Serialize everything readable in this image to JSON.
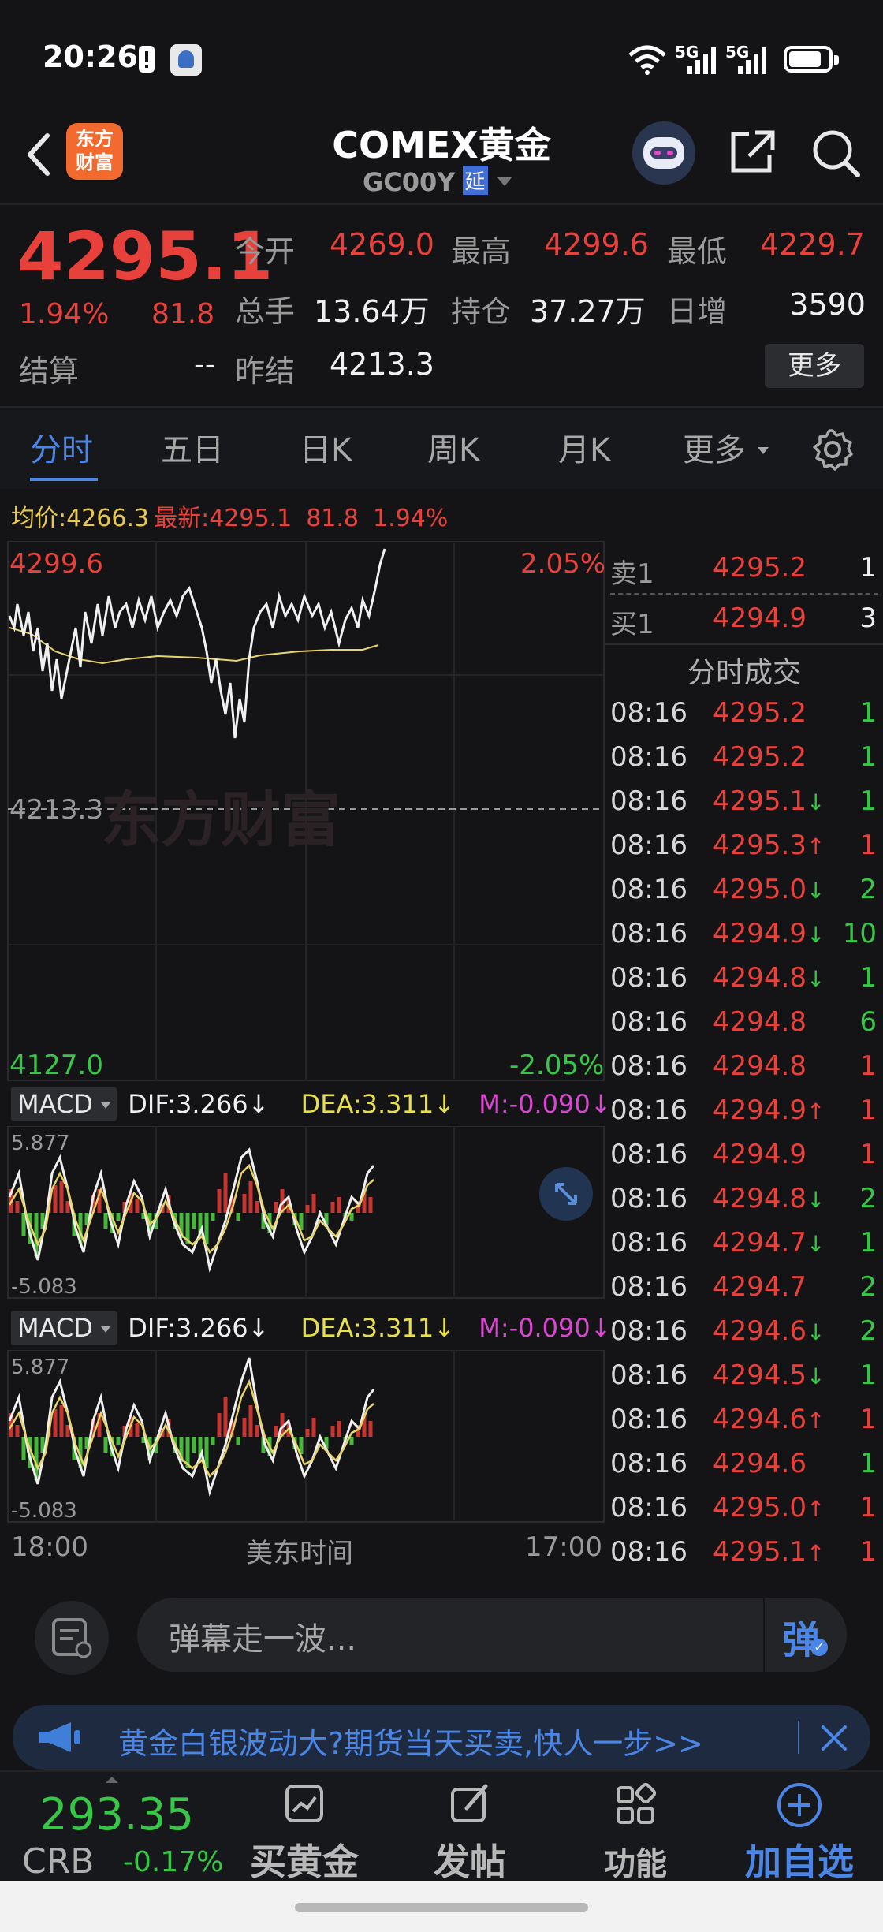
{
  "status_bar": {
    "time": "20:26",
    "signal1": "5G",
    "signal2": "5G"
  },
  "header": {
    "back_label": "<",
    "logo_line1": "东方",
    "logo_line2": "财富",
    "title": "COMEX黄金",
    "code": "GC00Y",
    "delay_badge": "延"
  },
  "quote": {
    "price": "4295.1",
    "change_pct": "1.94%",
    "change_abs": "81.8",
    "open_label": "今开",
    "open": "4269.0",
    "high_label": "最高",
    "high": "4299.6",
    "low_label": "最低",
    "low": "4229.7",
    "volume_label": "总手",
    "volume": "13.64万",
    "oi_label": "持仓",
    "oi": "37.27万",
    "daily_inc_label": "日增",
    "daily_inc": "3590",
    "settle_label": "结算",
    "settle": "--",
    "prev_settle_label": "昨结",
    "prev_settle": "4213.3",
    "more_button": "更多"
  },
  "tabs": {
    "t1": "分时",
    "t2": "五日",
    "t3": "日K",
    "t4": "周K",
    "t5": "月K",
    "t6": "更多"
  },
  "info_line": {
    "avg_label": "均价:",
    "avg": "4266.3",
    "latest_label": "最新:",
    "latest": "4295.1",
    "chg": "81.8",
    "pct": "1.94%"
  },
  "chart": {
    "max_label": "4299.6",
    "max_pct": "2.05%",
    "mid_label": "4213.3",
    "min_label": "4127.0",
    "min_pct": "-2.05%",
    "watermark": "东方财富",
    "time_start": "18:00",
    "time_mid": "美东时间",
    "time_end": "17:00"
  },
  "macd1": {
    "name": "MACD",
    "dif": "DIF:3.266↓",
    "dea": "DEA:3.311↓",
    "m": "M:-0.090↓",
    "top": "5.877",
    "bottom": "-5.083"
  },
  "macd2": {
    "name": "MACD",
    "dif": "DIF:3.266↓",
    "dea": "DEA:3.311↓",
    "m": "M:-0.090↓",
    "top": "5.877",
    "bottom": "-5.083"
  },
  "orderbook": {
    "sell_label": "卖1",
    "sell_price": "4295.2",
    "sell_vol": "1",
    "buy_label": "买1",
    "buy_price": "4294.9",
    "buy_vol": "3",
    "trades_title": "分时成交",
    "trades": [
      {
        "time": "08:16",
        "price": "4295.2",
        "arrow": "",
        "vol": "1",
        "vol_color": "green"
      },
      {
        "time": "08:16",
        "price": "4295.2",
        "arrow": "",
        "vol": "1",
        "vol_color": "green"
      },
      {
        "time": "08:16",
        "price": "4295.1",
        "arrow": "↓",
        "vol": "1",
        "vol_color": "green"
      },
      {
        "time": "08:16",
        "price": "4295.3",
        "arrow": "↑",
        "vol": "1",
        "vol_color": "red"
      },
      {
        "time": "08:16",
        "price": "4295.0",
        "arrow": "↓",
        "vol": "2",
        "vol_color": "green"
      },
      {
        "time": "08:16",
        "price": "4294.9",
        "arrow": "↓",
        "vol": "10",
        "vol_color": "green"
      },
      {
        "time": "08:16",
        "price": "4294.8",
        "arrow": "↓",
        "vol": "1",
        "vol_color": "green"
      },
      {
        "time": "08:16",
        "price": "4294.8",
        "arrow": "",
        "vol": "6",
        "vol_color": "green"
      },
      {
        "time": "08:16",
        "price": "4294.8",
        "arrow": "",
        "vol": "1",
        "vol_color": "red"
      },
      {
        "time": "08:16",
        "price": "4294.9",
        "arrow": "↑",
        "vol": "1",
        "vol_color": "red"
      },
      {
        "time": "08:16",
        "price": "4294.9",
        "arrow": "",
        "vol": "1",
        "vol_color": "red"
      },
      {
        "time": "08:16",
        "price": "4294.8",
        "arrow": "↓",
        "vol": "2",
        "vol_color": "green"
      },
      {
        "time": "08:16",
        "price": "4294.7",
        "arrow": "↓",
        "vol": "1",
        "vol_color": "green"
      },
      {
        "time": "08:16",
        "price": "4294.7",
        "arrow": "",
        "vol": "2",
        "vol_color": "green"
      },
      {
        "time": "08:16",
        "price": "4294.6",
        "arrow": "↓",
        "vol": "2",
        "vol_color": "green"
      },
      {
        "time": "08:16",
        "price": "4294.5",
        "arrow": "↓",
        "vol": "1",
        "vol_color": "green"
      },
      {
        "time": "08:16",
        "price": "4294.6",
        "arrow": "↑",
        "vol": "1",
        "vol_color": "red"
      },
      {
        "time": "08:16",
        "price": "4294.6",
        "arrow": "",
        "vol": "1",
        "vol_color": "green"
      },
      {
        "time": "08:16",
        "price": "4295.0",
        "arrow": "↑",
        "vol": "1",
        "vol_color": "red"
      },
      {
        "time": "08:16",
        "price": "4295.1",
        "arrow": "↑",
        "vol": "1",
        "vol_color": "red"
      }
    ]
  },
  "comment": {
    "placeholder": "弹幕走一波...",
    "danmu_button": "弹"
  },
  "banner": {
    "text": "黄金白银波动大?期货当天买卖,快人一步>>"
  },
  "bottom_nav": {
    "crb_value": "293.35",
    "crb_label": "CRB",
    "crb_change": "-0.17%",
    "buy_gold": "买黄金",
    "post": "发帖",
    "functions": "功能",
    "add_watch": "加自选"
  }
}
